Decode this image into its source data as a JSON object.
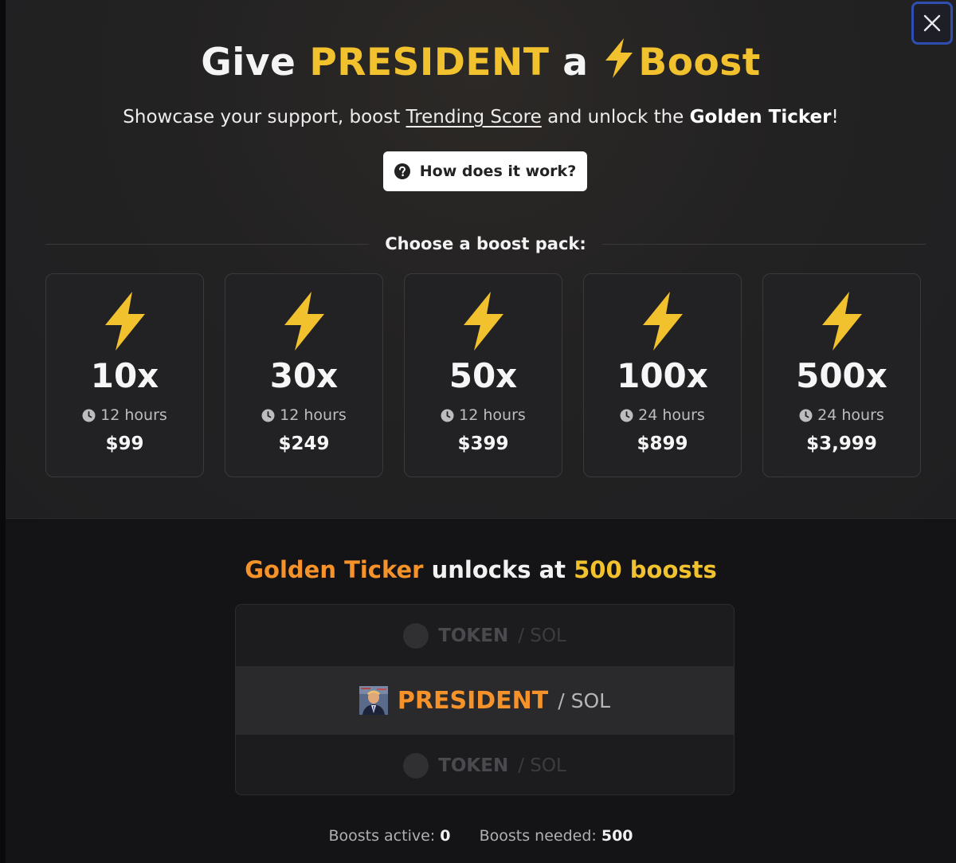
{
  "modal": {
    "close_label": "×",
    "title": {
      "prefix": "Give",
      "token": "PRESIDENT",
      "middle": "a",
      "suffix": "Boost"
    },
    "subtitle": {
      "part1": "Showcase your support, boost",
      "link": "Trending Score",
      "part2": "and unlock the",
      "bold": "Golden Ticker",
      "end": "!"
    },
    "how_button": "How does it work?",
    "choose_label": "Choose a boost pack:",
    "packs": [
      {
        "multiplier": "10x",
        "duration": "12 hours",
        "price": "$99"
      },
      {
        "multiplier": "30x",
        "duration": "12 hours",
        "price": "$249"
      },
      {
        "multiplier": "50x",
        "duration": "12 hours",
        "price": "$399"
      },
      {
        "multiplier": "100x",
        "duration": "24 hours",
        "price": "$899"
      },
      {
        "multiplier": "500x",
        "duration": "24 hours",
        "price": "$3,999"
      }
    ],
    "golden": {
      "name": "Golden Ticker",
      "middle": "unlocks at",
      "threshold": "500 boosts"
    },
    "ticker_rows": [
      {
        "token": "TOKEN",
        "pair": "/ SOL",
        "state": "placeholder"
      },
      {
        "token": "PRESIDENT",
        "pair": "/ SOL",
        "state": "current"
      },
      {
        "token": "TOKEN",
        "pair": "/ SOL",
        "state": "placeholder"
      }
    ],
    "stats": {
      "active_label": "Boosts active:",
      "active_value": "0",
      "needed_label": "Boosts needed:",
      "needed_value": "500"
    }
  },
  "colors": {
    "gold": "#f2c12e",
    "orange": "#f5922a",
    "close_focus_ring": "#2f4fb0"
  },
  "icons": [
    "close-icon",
    "bolt-icon",
    "question-circle-icon",
    "clock-icon",
    "token-avatar"
  ]
}
